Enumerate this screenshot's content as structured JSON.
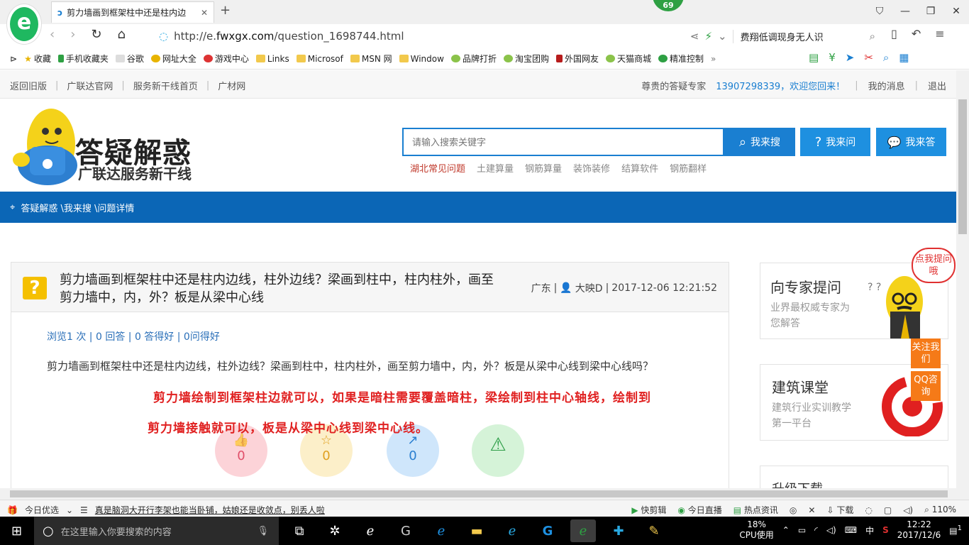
{
  "browser": {
    "tab_title": "剪力墙画到框架柱中还是柱内边",
    "badge_count": "69",
    "url_prefix": "http://e.",
    "url_domain": "fwxgx.com",
    "url_path": "/question_1698744.html",
    "search_suggest": "费翔低调现身无人识",
    "bookmarks": [
      "收藏",
      "手机收藏夹",
      "谷歌",
      "网址大全",
      "游戏中心",
      "Links",
      "Microsof",
      "MSN 网",
      "Window",
      "品牌打折",
      "淘宝团购",
      "外国网友",
      "天猫商城",
      "精准控制"
    ],
    "bookmark_more": "»"
  },
  "topbar": {
    "left": [
      "返回旧版",
      "广联达官网",
      "服务新干线首页",
      "广材网"
    ],
    "greeting": "尊贵的答疑专家",
    "user": "13907298339，欢迎您回来！",
    "messages": "我的消息",
    "logout": "退出"
  },
  "header": {
    "brand": "答疑解惑",
    "brand_sub": "广联达服务新干线",
    "search_placeholder": "请输入搜索关键字",
    "btn_search": "我来搜",
    "btn_ask": "我来问",
    "btn_answer": "我来答",
    "hot_links": [
      "湖北常见问题",
      "土建算量",
      "钢筋算量",
      "装饰装修",
      "结算软件",
      "钢筋翻样"
    ]
  },
  "breadcrumb": "答疑解惑 \\我来搜 \\问题详情",
  "question": {
    "icon": "?",
    "title": "剪力墙画到框架柱中还是柱内边线，柱外边线？梁画到柱中，柱内柱外，画至剪力墙中，内，外？板是从梁中心线",
    "region": "广东",
    "author": "大映D",
    "datetime": "2017-12-06 12:21:52",
    "stats": "浏览1 次 | 0 回答 | 0 答得好 | 0问得好",
    "text": "剪力墙画到框架柱中还是柱内边线，柱外边线？梁画到柱中，柱内柱外，画至剪力墙中，内，外？板是从梁中心线到梁中心线吗？",
    "answer_line1": "剪力墙绘制到框架柱边就可以，如果是暗柱需要覆盖暗柱，梁绘制到柱中心轴线，绘制到",
    "answer_line2": "剪力墙接触就可以，板是从梁中心线到梁中心线。",
    "actions": [
      {
        "icon": "thumb-up-icon",
        "glyph": "👍",
        "count": "0"
      },
      {
        "icon": "star-icon",
        "glyph": "☆",
        "count": "0"
      },
      {
        "icon": "share-icon",
        "glyph": "↗",
        "count": "0"
      },
      {
        "icon": "warning-icon",
        "glyph": "⚠",
        "count": ""
      }
    ]
  },
  "sidebar": {
    "expert_title": "向专家提问",
    "expert_sub": "业界最权威专家为您解答",
    "bubble": "点我提问哦",
    "class_title": "建筑课堂",
    "class_sub": "建筑行业实训教学第一平台",
    "download_title": "升级下载",
    "follow": "关注我们",
    "qq": "QQ咨询"
  },
  "statusbar": {
    "today": "今日优选",
    "news": "真是脑洞大开行李架也能当卧铺，姑娘还是收敛点，别丢人啦",
    "items": [
      "快剪辑",
      "今日直播",
      "热点资讯",
      "下载"
    ],
    "zoom": "110%"
  },
  "taskbar": {
    "search_placeholder": "在这里输入你要搜索的内容",
    "cpu_value": "18%",
    "cpu_label": "CPU使用",
    "ime": "中",
    "time": "12:22",
    "date": "2017/12/6",
    "notif_count": "1"
  },
  "colors": {
    "brand_blue": "#1a7fd1",
    "crumb_blue": "#0b66b6",
    "answer_red": "#e02020",
    "accent_orange": "#f57a18"
  }
}
